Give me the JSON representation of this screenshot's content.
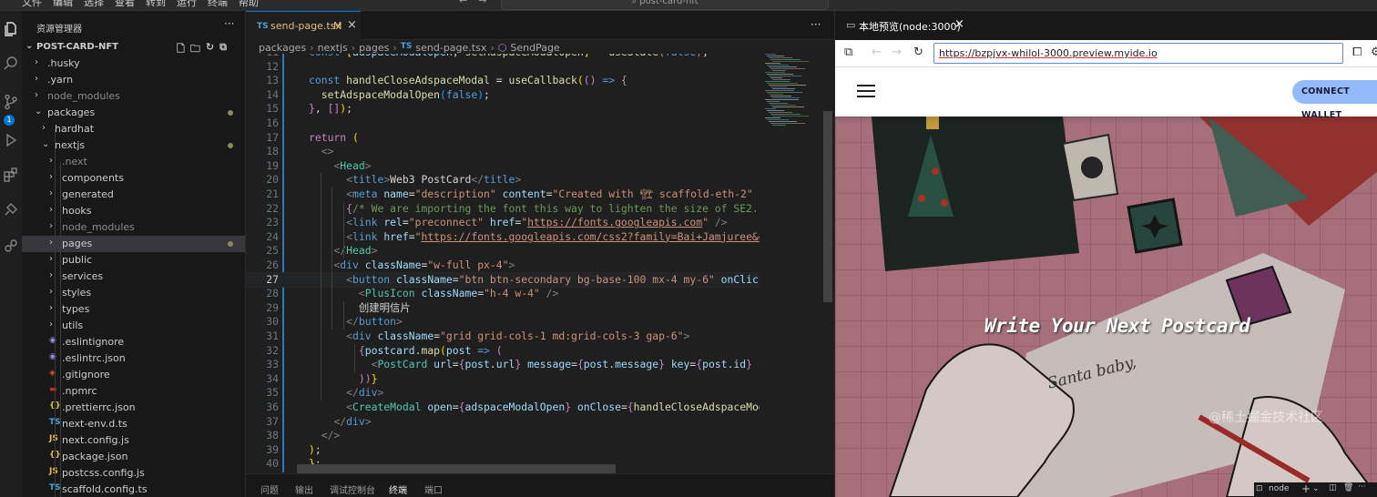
{
  "menu": [
    "文件",
    "编辑",
    "选择",
    "查看",
    "转到",
    "运行",
    "终端",
    "帮助"
  ],
  "command_center": "post-card-nft",
  "explorer": {
    "title": "资源管理器",
    "root": "POST-CARD-NFT",
    "items": [
      {
        "label": ".husky",
        "type": "folder"
      },
      {
        "label": ".yarn",
        "type": "folder"
      },
      {
        "label": "node_modules",
        "type": "folder"
      },
      {
        "label": "packages",
        "type": "folder-open"
      },
      {
        "label": "hardhat",
        "type": "folder"
      },
      {
        "label": "nextjs",
        "type": "folder-open"
      },
      {
        "label": ".next",
        "type": "folder"
      },
      {
        "label": "components",
        "type": "folder"
      },
      {
        "label": "generated",
        "type": "folder"
      },
      {
        "label": "hooks",
        "type": "folder"
      },
      {
        "label": "node_modules",
        "type": "folder"
      },
      {
        "label": "pages",
        "type": "folder"
      },
      {
        "label": "public",
        "type": "folder"
      },
      {
        "label": "services",
        "type": "folder"
      },
      {
        "label": "styles",
        "type": "folder"
      },
      {
        "label": "types",
        "type": "folder"
      },
      {
        "label": "utils",
        "type": "folder"
      },
      {
        "label": ".eslintignore",
        "type": "file"
      },
      {
        "label": ".eslintrc.json",
        "type": "file"
      },
      {
        "label": ".gitignore",
        "type": "file"
      },
      {
        "label": ".npmrc",
        "type": "file"
      },
      {
        "label": ".prettierrc.json",
        "type": "file"
      },
      {
        "label": "next-env.d.ts",
        "type": "file"
      },
      {
        "label": "next.config.js",
        "type": "file"
      },
      {
        "label": "package.json",
        "type": "file"
      },
      {
        "label": "postcss.config.js",
        "type": "file"
      },
      {
        "label": "scaffold.config.ts",
        "type": "file"
      }
    ],
    "badge_count": "1"
  },
  "editor": {
    "tab_prefix": "TS",
    "tab_label": "send-page.tsx",
    "tab_status": "M",
    "breadcrumbs": [
      "packages",
      "nextjs",
      "pages",
      "send-page.tsx",
      "SendPage"
    ],
    "current_line": "27",
    "line_numbers": [
      "11",
      "12",
      "13",
      "14",
      "15",
      "16",
      "17",
      "18",
      "19",
      "20",
      "21",
      "22",
      "23",
      "24",
      "25",
      "26",
      "27",
      "28",
      "29",
      "30",
      "31",
      "32",
      "33",
      "34",
      "35",
      "36",
      "37",
      "38",
      "39",
      "40"
    ]
  },
  "panel_tabs": [
    "问题",
    "输出",
    "调试控制台",
    "终端",
    "端口"
  ],
  "panel_right": "node",
  "preview": {
    "tab_title": "本地预览(node:3000)",
    "url": "https://bzpjvx-whilol-3000.preview.myide.io",
    "connect_label": "CONNECT WALLET",
    "hero_title": "Write Your Next Postcard",
    "handwriting": "Santa baby,",
    "watermark": "@稀土掘金技术社区"
  }
}
